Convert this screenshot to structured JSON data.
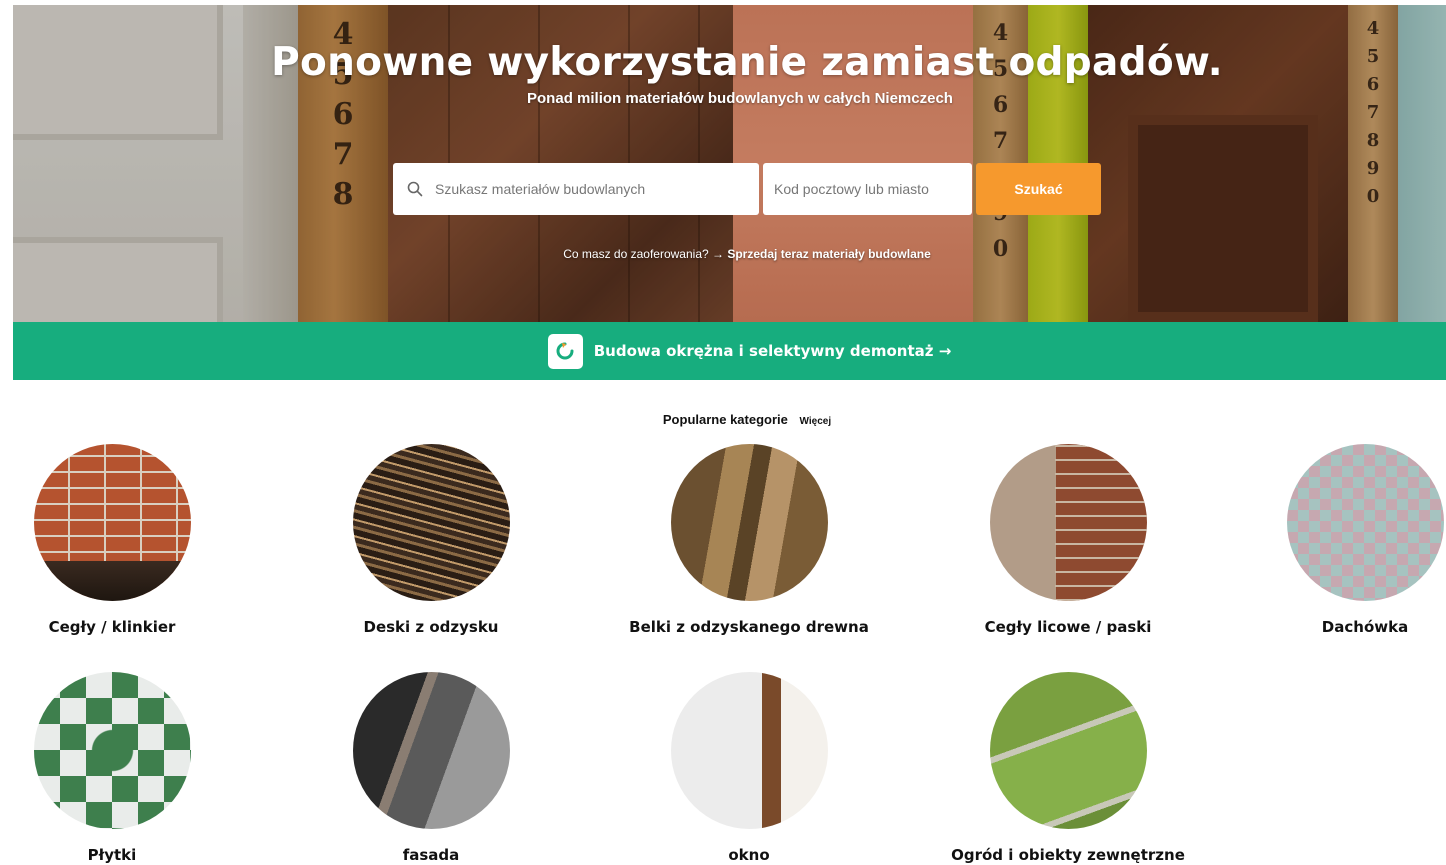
{
  "hero": {
    "title": "Ponowne wykorzystanie zamiast odpadów.",
    "subtitle": "Ponad milion materiałów budowlanych w całych Niemczech",
    "search_placeholder": "Szukasz materiałów budowlanych",
    "zip_placeholder": "Kod pocztowy lub miasto",
    "search_button": "Szukać",
    "offer_question": "Co masz do zaoferowania?",
    "offer_link": "→ Sprzedaj teraz materiały budowlane",
    "ruler_left_digits": "4\n5\n6\n7\n8",
    "ruler_mid_digits": "4\n5\n6\n7\n8\n9\n0",
    "ruler_right_digits": "4\n5\n6\n7\n8\n9\n0"
  },
  "banner": {
    "label": "Budowa okrężna i selektywny demontaż →",
    "accent_color": "#17ad7e"
  },
  "categories": {
    "heading": "Popularne kategorie",
    "more": "Więcej",
    "items": [
      {
        "label": "Cegły / klinkier"
      },
      {
        "label": "Deski z odzysku"
      },
      {
        "label": "Belki z odzyskanego drewna"
      },
      {
        "label": "Cegły licowe / paski"
      },
      {
        "label": "Dachówka"
      },
      {
        "label": "Płytki"
      },
      {
        "label": "fasada"
      },
      {
        "label": "okno"
      },
      {
        "label": "Ogród i obiekty zewnętrzne"
      }
    ]
  },
  "colors": {
    "search_button": "#f6992d",
    "banner": "#17ad7e"
  }
}
